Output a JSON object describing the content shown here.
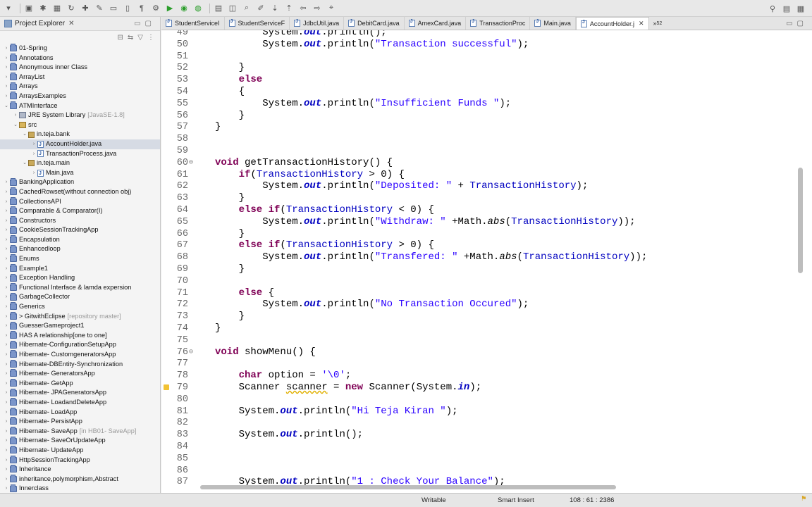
{
  "explorer": {
    "title": "Project Explorer",
    "items": [
      {
        "label": "01-Spring",
        "level": 0,
        "type": "project"
      },
      {
        "label": "Annotations",
        "level": 0,
        "type": "project"
      },
      {
        "label": "Anonymous inner Class",
        "level": 0,
        "type": "project"
      },
      {
        "label": "ArrayList",
        "level": 0,
        "type": "project"
      },
      {
        "label": "Arrays",
        "level": 0,
        "type": "project"
      },
      {
        "label": "ArraysExamples",
        "level": 0,
        "type": "project"
      },
      {
        "label": "ATMInterface",
        "level": 0,
        "type": "project",
        "expanded": true
      },
      {
        "label": "JRE System Library",
        "suffix": "[JavaSE-1.8]",
        "level": 1,
        "type": "lib"
      },
      {
        "label": "src",
        "level": 1,
        "type": "src",
        "expanded": true
      },
      {
        "label": "in.teja.bank",
        "level": 2,
        "type": "pkg",
        "expanded": true
      },
      {
        "label": "AccountHolder.java",
        "level": 3,
        "type": "java",
        "selected": true
      },
      {
        "label": "TransactionProcess.java",
        "level": 3,
        "type": "java"
      },
      {
        "label": "in.teja.main",
        "level": 2,
        "type": "pkg",
        "expanded": true
      },
      {
        "label": "Main.java",
        "level": 3,
        "type": "java"
      },
      {
        "label": "BankingApplication",
        "level": 0,
        "type": "project"
      },
      {
        "label": "CachedRowset(without connection obj)",
        "level": 0,
        "type": "project"
      },
      {
        "label": "CollectionsAPI",
        "level": 0,
        "type": "project"
      },
      {
        "label": "Comparable & Comparator(I)",
        "level": 0,
        "type": "project"
      },
      {
        "label": "Constructors",
        "level": 0,
        "type": "project"
      },
      {
        "label": "CookieSessionTrackingApp",
        "level": 0,
        "type": "project"
      },
      {
        "label": "Encapsulation",
        "level": 0,
        "type": "project"
      },
      {
        "label": "Enhancedloop",
        "level": 0,
        "type": "project"
      },
      {
        "label": "Enums",
        "level": 0,
        "type": "project"
      },
      {
        "label": "Example1",
        "level": 0,
        "type": "project"
      },
      {
        "label": "Exception Handling",
        "level": 0,
        "type": "project"
      },
      {
        "label": "Functional Interface & lamda expersion",
        "level": 0,
        "type": "project"
      },
      {
        "label": "GarbageCollector",
        "level": 0,
        "type": "project"
      },
      {
        "label": "Generics",
        "level": 0,
        "type": "project"
      },
      {
        "label": "> GitwithEclipse",
        "suffix": "[repository master]",
        "level": 0,
        "type": "project"
      },
      {
        "label": "GuesserGameproject1",
        "level": 0,
        "type": "project"
      },
      {
        "label": "HAS A relationship[one to one]",
        "level": 0,
        "type": "project"
      },
      {
        "label": "Hibernate-ConfigurationSetupApp",
        "level": 0,
        "type": "project"
      },
      {
        "label": "Hibernate- CustomgeneratorsApp",
        "level": 0,
        "type": "project"
      },
      {
        "label": "Hibernate-DBEntity-Synchronization",
        "level": 0,
        "type": "project"
      },
      {
        "label": "Hibernate- GeneratorsApp",
        "level": 0,
        "type": "project"
      },
      {
        "label": "Hibernate- GetApp",
        "level": 0,
        "type": "project"
      },
      {
        "label": "Hibernate- JPAGeneratorsApp",
        "level": 0,
        "type": "project"
      },
      {
        "label": "Hibernate- LoadandDeleteApp",
        "level": 0,
        "type": "project"
      },
      {
        "label": "Hibernate- LoadApp",
        "level": 0,
        "type": "project"
      },
      {
        "label": "Hibernate- PersistApp",
        "level": 0,
        "type": "project"
      },
      {
        "label": "Hibernate- SaveApp",
        "suffix": "[in HB01- SaveApp]",
        "level": 0,
        "type": "project"
      },
      {
        "label": "Hibernate- SaveOrUpdateApp",
        "level": 0,
        "type": "project"
      },
      {
        "label": "Hibernate- UpdateApp",
        "level": 0,
        "type": "project"
      },
      {
        "label": "HttpSessionTrackingApp",
        "level": 0,
        "type": "project"
      },
      {
        "label": "Inheritance",
        "level": 0,
        "type": "project"
      },
      {
        "label": "inheritance,polymorphism,Abstract",
        "level": 0,
        "type": "project"
      },
      {
        "label": "Innerclass",
        "level": 0,
        "type": "project"
      }
    ]
  },
  "editor_tabs": {
    "items": [
      "StudentServiceI",
      "StudentServiceF",
      "JdbcUtil.java",
      "DebitCard.java",
      "AmexCard.java",
      "TransactionProc",
      "Main.java",
      "AccountHolder.j"
    ],
    "active_index": 7,
    "overflow": "52"
  },
  "code": {
    "lines": [
      {
        "n": "49",
        "tokens": [
          [
            "t",
            "        System."
          ],
          [
            "sf",
            "out"
          ],
          [
            "t",
            ".println();"
          ]
        ]
      },
      {
        "n": "50",
        "tokens": [
          [
            "t",
            "        System."
          ],
          [
            "sf",
            "out"
          ],
          [
            "t",
            ".println("
          ],
          [
            "s",
            "\"Transaction successful\""
          ],
          [
            "t",
            ");"
          ]
        ]
      },
      {
        "n": "51",
        "tokens": []
      },
      {
        "n": "52",
        "tokens": [
          [
            "t",
            "    }"
          ]
        ]
      },
      {
        "n": "53",
        "tokens": [
          [
            "k",
            "    else"
          ]
        ]
      },
      {
        "n": "54",
        "tokens": [
          [
            "t",
            "    {"
          ]
        ]
      },
      {
        "n": "55",
        "tokens": [
          [
            "t",
            "        System."
          ],
          [
            "sf",
            "out"
          ],
          [
            "t",
            ".println("
          ],
          [
            "s",
            "\"Insufficient Funds \""
          ],
          [
            "t",
            ");"
          ]
        ]
      },
      {
        "n": "56",
        "tokens": [
          [
            "t",
            "    }"
          ]
        ]
      },
      {
        "n": "57",
        "tokens": [
          [
            "t",
            "}"
          ]
        ]
      },
      {
        "n": "58",
        "tokens": []
      },
      {
        "n": "59",
        "tokens": []
      },
      {
        "n": "60",
        "fold": true,
        "tokens": [
          [
            "k",
            "void"
          ],
          [
            "t",
            " getTransactionHistory() {"
          ]
        ]
      },
      {
        "n": "61",
        "tokens": [
          [
            "k",
            "    if"
          ],
          [
            "t",
            "("
          ],
          [
            "f",
            "TransactionHistory"
          ],
          [
            "t",
            " > 0) {"
          ]
        ]
      },
      {
        "n": "62",
        "tokens": [
          [
            "t",
            "        System."
          ],
          [
            "sf",
            "out"
          ],
          [
            "t",
            ".println("
          ],
          [
            "s",
            "\"Deposited: \""
          ],
          [
            "t",
            " + "
          ],
          [
            "f",
            "TransactionHistory"
          ],
          [
            "t",
            ");"
          ]
        ]
      },
      {
        "n": "63",
        "tokens": [
          [
            "t",
            "    }"
          ]
        ]
      },
      {
        "n": "64",
        "tokens": [
          [
            "k",
            "    else if"
          ],
          [
            "t",
            "("
          ],
          [
            "f",
            "TransactionHistory"
          ],
          [
            "t",
            " < 0) {"
          ]
        ]
      },
      {
        "n": "65",
        "tokens": [
          [
            "t",
            "        System."
          ],
          [
            "sf",
            "out"
          ],
          [
            "t",
            ".println("
          ],
          [
            "s",
            "\"Withdraw: \""
          ],
          [
            "t",
            " +Math."
          ],
          [
            "i",
            "abs"
          ],
          [
            "t",
            "("
          ],
          [
            "f",
            "TransactionHistory"
          ],
          [
            "t",
            "));"
          ]
        ]
      },
      {
        "n": "66",
        "tokens": [
          [
            "t",
            "    }"
          ]
        ]
      },
      {
        "n": "67",
        "tokens": [
          [
            "k",
            "    else if"
          ],
          [
            "t",
            "("
          ],
          [
            "f",
            "TransactionHistory"
          ],
          [
            "t",
            " > 0) {"
          ]
        ]
      },
      {
        "n": "68",
        "tokens": [
          [
            "t",
            "        System."
          ],
          [
            "sf",
            "out"
          ],
          [
            "t",
            ".println("
          ],
          [
            "s",
            "\"Transfered: \""
          ],
          [
            "t",
            " +Math."
          ],
          [
            "i",
            "abs"
          ],
          [
            "t",
            "("
          ],
          [
            "f",
            "TransactionHistory"
          ],
          [
            "t",
            "));"
          ]
        ]
      },
      {
        "n": "69",
        "tokens": [
          [
            "t",
            "    }"
          ]
        ]
      },
      {
        "n": "70",
        "tokens": []
      },
      {
        "n": "71",
        "tokens": [
          [
            "k",
            "    else"
          ],
          [
            "t",
            " {"
          ]
        ]
      },
      {
        "n": "72",
        "tokens": [
          [
            "t",
            "        System."
          ],
          [
            "sf",
            "out"
          ],
          [
            "t",
            ".println("
          ],
          [
            "s",
            "\"No Transaction Occured\""
          ],
          [
            "t",
            ");"
          ]
        ]
      },
      {
        "n": "73",
        "tokens": [
          [
            "t",
            "    }"
          ]
        ]
      },
      {
        "n": "74",
        "tokens": [
          [
            "t",
            "}"
          ]
        ]
      },
      {
        "n": "75",
        "tokens": []
      },
      {
        "n": "76",
        "fold": true,
        "tokens": [
          [
            "k",
            "void"
          ],
          [
            "t",
            " showMenu() {"
          ]
        ]
      },
      {
        "n": "77",
        "tokens": []
      },
      {
        "n": "78",
        "tokens": [
          [
            "k",
            "    char"
          ],
          [
            "t",
            " option = "
          ],
          [
            "s",
            "'\\0'"
          ],
          [
            "t",
            ";"
          ]
        ]
      },
      {
        "n": "79",
        "warn": true,
        "tokens": [
          [
            "t",
            "    Scanner "
          ],
          [
            "u",
            "scanner"
          ],
          [
            "t",
            " = "
          ],
          [
            "k",
            "new"
          ],
          [
            "t",
            " Scanner(System."
          ],
          [
            "sf",
            "in"
          ],
          [
            "t",
            ");"
          ]
        ]
      },
      {
        "n": "80",
        "tokens": []
      },
      {
        "n": "81",
        "tokens": [
          [
            "t",
            "    System."
          ],
          [
            "sf",
            "out"
          ],
          [
            "t",
            ".println("
          ],
          [
            "s",
            "\"Hi Teja Kiran \""
          ],
          [
            "t",
            ");"
          ]
        ]
      },
      {
        "n": "82",
        "tokens": []
      },
      {
        "n": "83",
        "tokens": [
          [
            "t",
            "    System."
          ],
          [
            "sf",
            "out"
          ],
          [
            "t",
            ".println();"
          ]
        ]
      },
      {
        "n": "84",
        "tokens": []
      },
      {
        "n": "85",
        "tokens": []
      },
      {
        "n": "86",
        "tokens": []
      },
      {
        "n": "87",
        "tokens": [
          [
            "t",
            "    System."
          ],
          [
            "sf",
            "out"
          ],
          [
            "t",
            ".println("
          ],
          [
            "s",
            "\"1 : Check Your Balance\""
          ],
          [
            "t",
            ");"
          ]
        ]
      }
    ]
  },
  "status": {
    "mode": "Writable",
    "insert": "Smart Insert",
    "position": "108 : 61 : 2386"
  }
}
